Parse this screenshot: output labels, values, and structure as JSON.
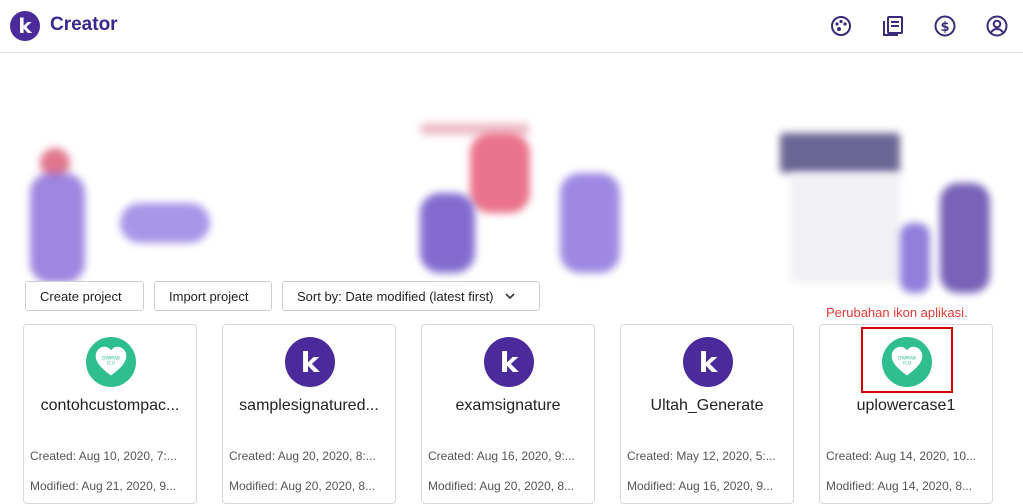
{
  "app": {
    "logo_letter": "k",
    "title": "Creator"
  },
  "header_icons": [
    "palette-icon",
    "library-icon",
    "dollar-icon",
    "account-icon"
  ],
  "toolbar": {
    "create_label": "Create project",
    "import_label": "Import project",
    "sort_label": "Sort by: Date modified (latest first)"
  },
  "annotation": {
    "note": "Perubahan ikon aplikasi."
  },
  "heart_icon_text": {
    "line1": "DWMAB",
    "line2": "ICU"
  },
  "projects": [
    {
      "name": "contohcustompac...",
      "icon": "heart",
      "created": "Created: Aug 10, 2020, 7:...",
      "modified": "Modified: Aug 21, 2020, 9..."
    },
    {
      "name": "samplesignatured...",
      "icon": "k",
      "created": "Created: Aug 20, 2020, 8:...",
      "modified": "Modified: Aug 20, 2020, 8..."
    },
    {
      "name": "examsignature",
      "icon": "k",
      "created": "Created: Aug 16, 2020, 9:...",
      "modified": "Modified: Aug 20, 2020, 8..."
    },
    {
      "name": "Ultah_Generate",
      "icon": "k",
      "created": "Created: May 12, 2020, 5:...",
      "modified": "Modified: Aug 16, 2020, 9..."
    },
    {
      "name": "uplowercase1",
      "icon": "heart",
      "created": "Created: Aug 14, 2020, 10...",
      "modified": "Modified: Aug 14, 2020, 8..."
    }
  ],
  "colors": {
    "brand": "#4b2a9b",
    "heart_bg": "#2fbf8f",
    "annotation": "#e53935"
  }
}
